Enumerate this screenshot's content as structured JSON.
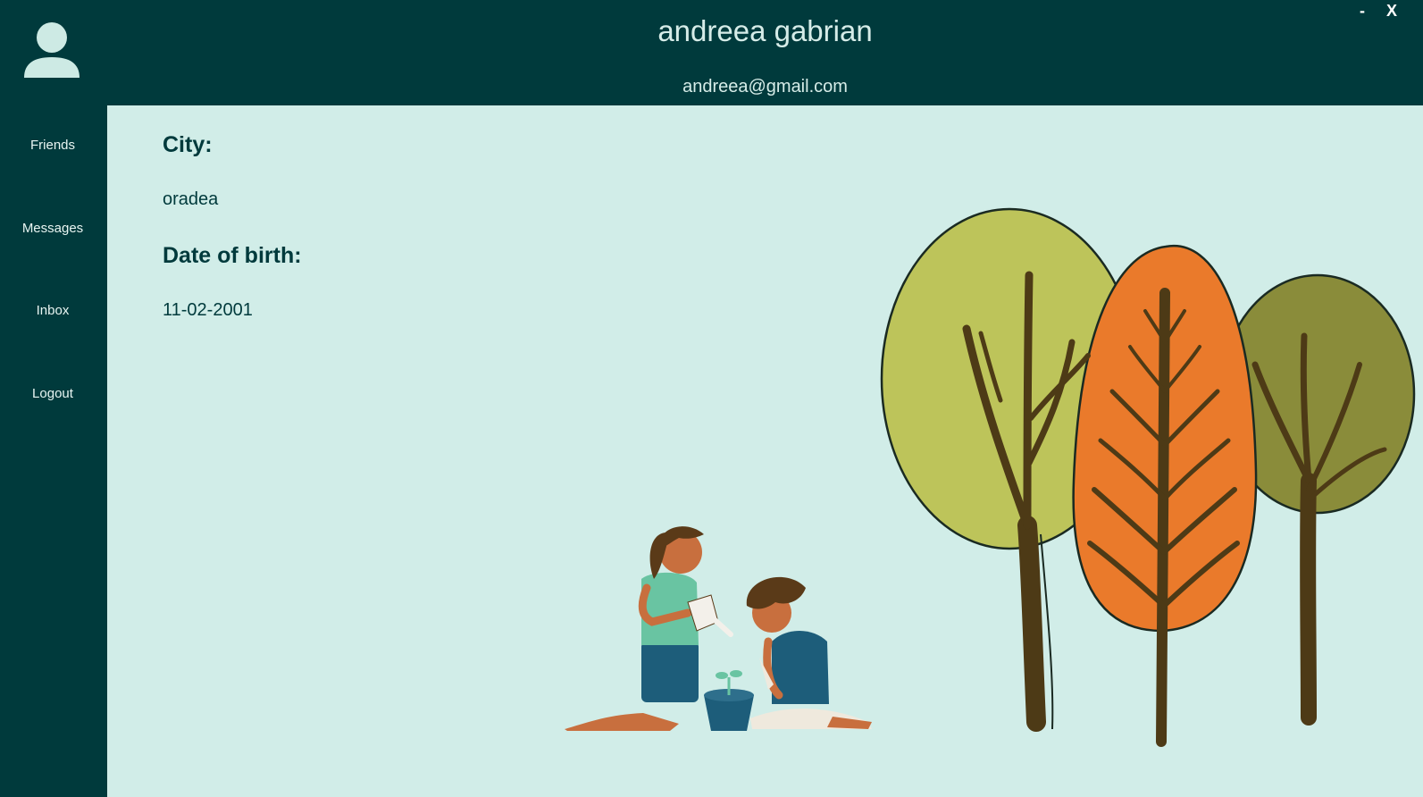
{
  "window": {
    "minimize_label": "-",
    "close_label": "X"
  },
  "sidebar": {
    "avatar_icon": "user-avatar-icon",
    "items": [
      {
        "label": "Friends"
      },
      {
        "label": "Messages"
      },
      {
        "label": "Inbox"
      },
      {
        "label": "Logout"
      }
    ]
  },
  "header": {
    "name": "andreea gabrian",
    "email": "andreea@gmail.com"
  },
  "profile": {
    "city_label": "City:",
    "city_value": "oradea",
    "dob_label": "Date of birth:",
    "dob_value": "11-02-2001"
  },
  "colors": {
    "sidebar_bg": "#003a3c",
    "content_bg": "#d1ede8",
    "tree_olive": "#bdc45a",
    "tree_orange": "#ea7a2b",
    "tree_dark_olive": "#8a8c3a",
    "trunk": "#4d3a16"
  },
  "illustration": {
    "icons": [
      "trees-illustration",
      "gardening-kids-illustration"
    ]
  }
}
